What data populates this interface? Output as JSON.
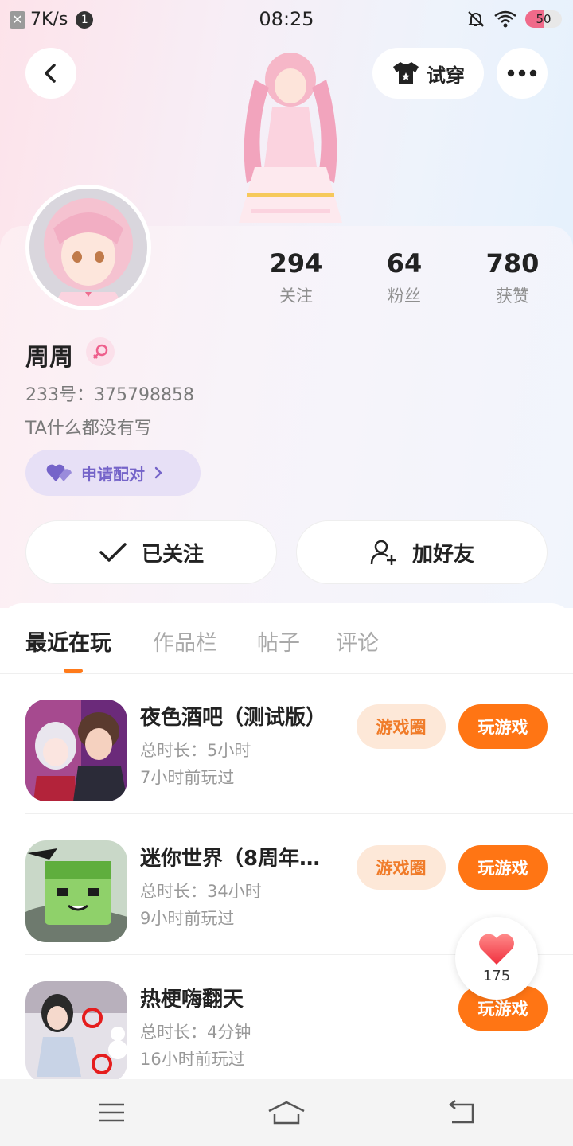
{
  "status_bar": {
    "speed": "7K/s",
    "notification_count": "1",
    "time": "08:25",
    "battery": "50",
    "battery_level": 0.5
  },
  "header": {
    "try_on_label": "试穿"
  },
  "profile": {
    "stats": [
      {
        "value": "294",
        "label": "关注"
      },
      {
        "value": "64",
        "label": "粉丝"
      },
      {
        "value": "780",
        "label": "获赞"
      }
    ],
    "name": "周周",
    "uid": "233号：375798858",
    "bio": "TA什么都没有写",
    "match_label": "申请配对",
    "followed_label": "已关注",
    "add_friend_label": "加好友"
  },
  "tabs": [
    {
      "label": "最近在玩",
      "active": true
    },
    {
      "label": "作品栏",
      "active": false
    },
    {
      "label": "帖子",
      "active": false
    },
    {
      "label": "评论",
      "active": false
    }
  ],
  "games": [
    {
      "title": "夜色酒吧（测试版）",
      "duration": "总时长：5小时",
      "last_played": "7小时前玩过",
      "circle_label": "游戏圈",
      "play_label": "玩游戏"
    },
    {
      "title": "迷你世界（8周年…",
      "duration": "总时长：34小时",
      "last_played": "9小时前玩过",
      "circle_label": "游戏圈",
      "play_label": "玩游戏"
    },
    {
      "title": "热梗嗨翻天",
      "duration": "总时长：4分钟",
      "last_played": "16小时前玩过",
      "play_label": "玩游戏"
    }
  ],
  "like_fab": {
    "count": "175"
  },
  "colors": {
    "accent": "#ff7514",
    "accent_soft": "#fde8d8",
    "match_purple": "#7564c9"
  }
}
